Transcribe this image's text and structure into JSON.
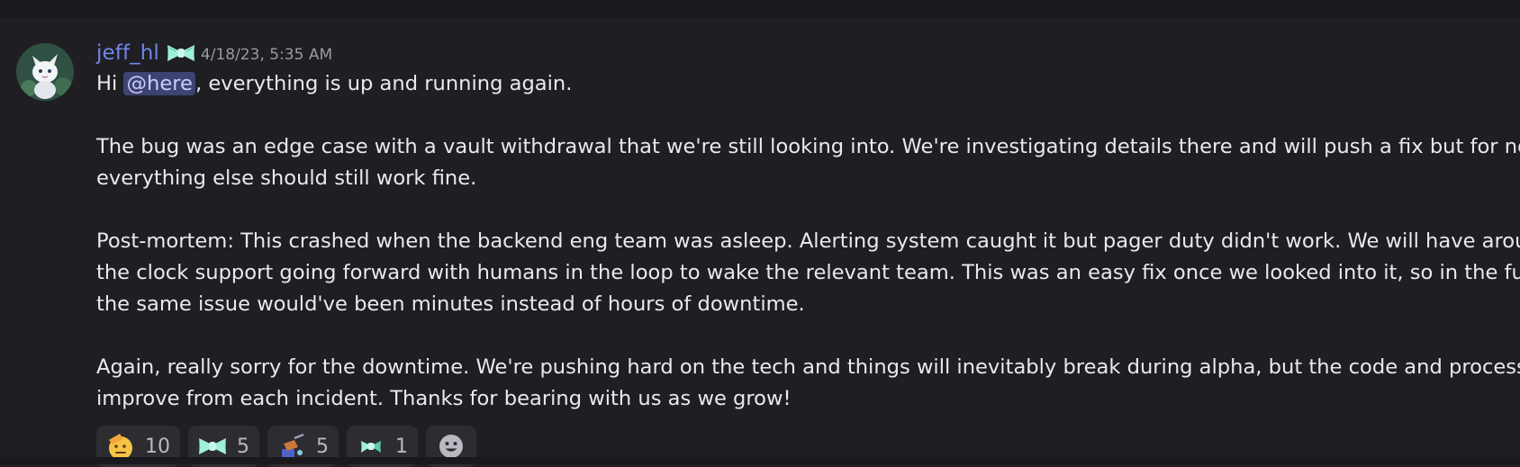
{
  "message": {
    "author": "jeff_hl",
    "timestamp": "4/18/23, 5:35 AM",
    "line1_prefix": "Hi ",
    "mention": "@here",
    "line1_suffix": ", everything is up and running again.",
    "para2_line1": "The bug was an edge case with a vault withdrawal that we're still looking into. We're investigating details there and will push a fix but for now",
    "para2_line2": "everything else should still work fine.",
    "para3_line1": "Post-mortem: This crashed when the backend eng team was asleep. Alerting system caught it but pager duty didn't work. We will have around",
    "para3_line2": "the clock support going forward with humans in the loop to wake the relevant team. This was an easy fix once we looked into it, so in the future",
    "para3_line3": "the same issue would've been minutes instead of hours of downtime.",
    "para4_line1": "Again, really sorry for the downtime. We're pushing hard on the tech and things will inevitably break during alpha, but the code and process will",
    "para4_line2": "improve from each incident. Thanks for bearing with us as we grow!"
  },
  "reactions": [
    {
      "icon": "saluting-face-icon",
      "count": "10"
    },
    {
      "icon": "bow-tie-emote-icon",
      "count": "5"
    },
    {
      "icon": "builder-emote-icon",
      "count": "5"
    },
    {
      "icon": "small-bow-emote-icon",
      "count": "1"
    }
  ],
  "colors": {
    "background": "#1f1e22",
    "username": "#6f86e8",
    "mention_bg": "#3e4372",
    "reaction_bg": "#2d2c31"
  }
}
